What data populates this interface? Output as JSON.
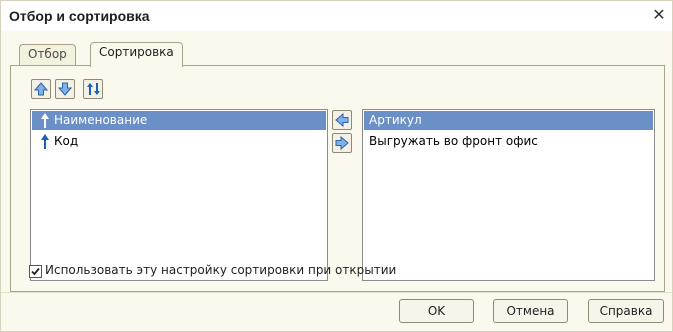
{
  "window": {
    "title": "Отбор и сортировка",
    "close_symbol": "✕"
  },
  "tabs": [
    {
      "label": "Отбор",
      "active": false
    },
    {
      "label": "Сортировка",
      "active": true
    }
  ],
  "toolbar": {
    "move_up_icon": "arrow-up-icon",
    "move_down_icon": "arrow-down-icon",
    "sort_direction_icon": "sort-toggle-icon"
  },
  "available_fields": [
    {
      "label": "Наименование",
      "direction": "ascending",
      "selected": true
    },
    {
      "label": "Код",
      "direction": "ascending",
      "selected": false
    }
  ],
  "sort_fields": [
    {
      "label": "Артикул",
      "selected": true
    },
    {
      "label": "Выгружать во фронт офис",
      "selected": false
    }
  ],
  "transfer": {
    "to_left_icon": "arrow-left-icon",
    "to_right_icon": "arrow-right-icon"
  },
  "use_on_open": {
    "checked": true,
    "label": "Использовать эту настройку сортировки при открытии"
  },
  "buttons": {
    "ok": "OK",
    "cancel": "Отмена",
    "help": "Справка"
  },
  "colors": {
    "selection": "#6b8fc7",
    "background": "#fbf9ee",
    "border": "#a8a38a",
    "sort_arrow": "#1c5fb3"
  }
}
